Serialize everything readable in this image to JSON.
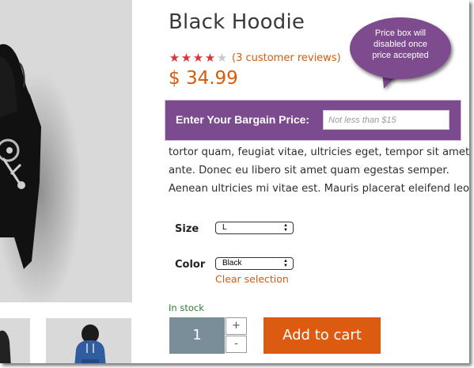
{
  "product": {
    "title": "Black Hoodie",
    "rating": 4,
    "rating_max": 5,
    "reviews_link": "(3 customer reviews)",
    "price": "$ 34.99"
  },
  "callout": {
    "line1": "Price box will",
    "line2": "disabled once",
    "line3": "price accepted"
  },
  "bargain": {
    "label": "Enter Your Bargain Price:",
    "placeholder": "Not less than $15"
  },
  "description": {
    "line1": "tortor quam, feugiat vitae, ultricies eget, tempor sit amet,",
    "line2": "ante. Donec eu libero sit amet quam egestas semper.",
    "line3": "Aenean ultricies mi vitae est. Mauris placerat eleifend leo."
  },
  "options": {
    "size_label": "Size",
    "size_value": "L",
    "color_label": "Color",
    "color_value": "Black",
    "clear_selection": "Clear selection"
  },
  "stock_status": "In stock",
  "cart": {
    "quantity": "1",
    "plus": "+",
    "minus": "-",
    "add_to_cart": "Add to cart"
  },
  "colors": {
    "accent_orange": "#d65b0a",
    "bargain_purple": "#7b4a8f",
    "star_red": "#dd3333",
    "qty_slate": "#7a8e99",
    "stock_green": "#2e7d32"
  },
  "images": {
    "main": "black-hoodie-image",
    "thumb_1": "hoodie-thumbnail",
    "thumb_2": "blue-hoodie-thumbnail"
  }
}
